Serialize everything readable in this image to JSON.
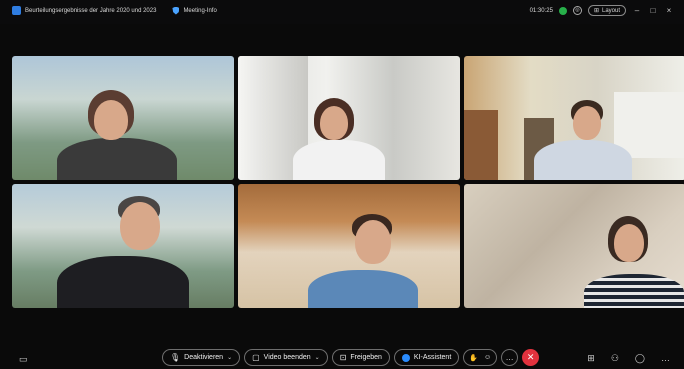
{
  "titlebar": {
    "meeting_title": "Beurteilungsergebnisse der Jahre 2020 und 2023",
    "meeting_info": "Meeting-Info",
    "timer": "01:30:25",
    "layout_label": "Layout"
  },
  "controls": {
    "mute_label": "Deaktivieren",
    "video_label": "Video beenden",
    "share_label": "Freigeben",
    "ai_label": "KI-Assistent"
  },
  "colors": {
    "end_call": "#e2323e",
    "status_green": "#27b04a",
    "ai_accent": "#2a8cff"
  }
}
